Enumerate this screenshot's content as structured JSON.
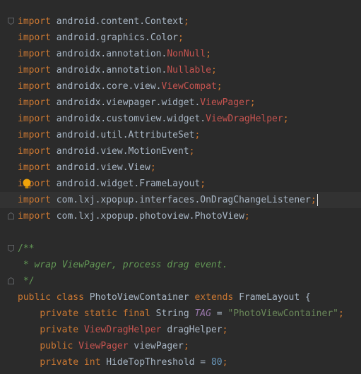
{
  "editor": {
    "lines": [
      {
        "tokens": [
          [
            "kw",
            "import"
          ],
          [
            "pkg",
            " android.content.Context"
          ],
          [
            "semi",
            ";"
          ]
        ]
      },
      {
        "tokens": [
          [
            "kw",
            "import"
          ],
          [
            "pkg",
            " android.graphics.Color"
          ],
          [
            "semi",
            ";"
          ]
        ]
      },
      {
        "tokens": [
          [
            "kw",
            "import"
          ],
          [
            "pkg",
            " androidx.annotation."
          ],
          [
            "cls-red",
            "NonNull"
          ],
          [
            "semi",
            ";"
          ]
        ]
      },
      {
        "tokens": [
          [
            "kw",
            "import"
          ],
          [
            "pkg",
            " androidx.annotation."
          ],
          [
            "cls-red",
            "Nullable"
          ],
          [
            "semi",
            ";"
          ]
        ]
      },
      {
        "tokens": [
          [
            "kw",
            "import"
          ],
          [
            "pkg",
            " androidx.core.view."
          ],
          [
            "cls-red",
            "ViewCompat"
          ],
          [
            "semi",
            ";"
          ]
        ]
      },
      {
        "tokens": [
          [
            "kw",
            "import"
          ],
          [
            "pkg",
            " androidx.viewpager.widget."
          ],
          [
            "cls-red",
            "ViewPager"
          ],
          [
            "semi",
            ";"
          ]
        ]
      },
      {
        "tokens": [
          [
            "kw",
            "import"
          ],
          [
            "pkg",
            " androidx.customview.widget."
          ],
          [
            "cls-red",
            "ViewDragHelper"
          ],
          [
            "semi",
            ";"
          ]
        ]
      },
      {
        "tokens": [
          [
            "kw",
            "import"
          ],
          [
            "pkg",
            " android.util.AttributeSet"
          ],
          [
            "semi",
            ";"
          ]
        ]
      },
      {
        "tokens": [
          [
            "kw",
            "import"
          ],
          [
            "pkg",
            " android.view.MotionEvent"
          ],
          [
            "semi",
            ";"
          ]
        ]
      },
      {
        "tokens": [
          [
            "kw",
            "import"
          ],
          [
            "pkg",
            " android.view.View"
          ],
          [
            "semi",
            ";"
          ]
        ]
      },
      {
        "tokens": [
          [
            "kw",
            "import"
          ],
          [
            "pkg",
            " android.widget.FrameLayout"
          ],
          [
            "semi",
            ";"
          ]
        ]
      },
      {
        "tokens": [
          [
            "kw",
            "import"
          ],
          [
            "pkg",
            " com.lxj.xpopup.interfaces.OnDragChangeListener"
          ],
          [
            "semi",
            ";"
          ]
        ]
      },
      {
        "tokens": [
          [
            "kw",
            "import"
          ],
          [
            "pkg",
            " com.lxj.xpopup.photoview.PhotoView"
          ],
          [
            "semi",
            ";"
          ]
        ]
      },
      {
        "tokens": []
      },
      {
        "tokens": [
          [
            "cdoc",
            "/**"
          ]
        ]
      },
      {
        "tokens": [
          [
            "comment",
            " * wrap ViewPager, process drag event."
          ]
        ]
      },
      {
        "tokens": [
          [
            "cdoc",
            " */"
          ]
        ]
      },
      {
        "tokens": [
          [
            "kw",
            "public class"
          ],
          [
            "pkg",
            " PhotoViewContainer "
          ],
          [
            "kw",
            "extends"
          ],
          [
            "pkg",
            " FrameLayout {"
          ]
        ]
      },
      {
        "tokens": [
          [
            "pkg",
            "    "
          ],
          [
            "kw",
            "private static final"
          ],
          [
            "pkg",
            " String "
          ],
          [
            "const",
            "TAG"
          ],
          [
            "pkg",
            " = "
          ],
          [
            "str",
            "\"PhotoViewContainer\""
          ],
          [
            "semi",
            ";"
          ]
        ]
      },
      {
        "tokens": [
          [
            "pkg",
            "    "
          ],
          [
            "kw",
            "private"
          ],
          [
            "pkg",
            " "
          ],
          [
            "cls-red",
            "ViewDragHelper"
          ],
          [
            "pkg",
            " dragHelper"
          ],
          [
            "semi",
            ";"
          ]
        ]
      },
      {
        "tokens": [
          [
            "pkg",
            "    "
          ],
          [
            "kw",
            "public"
          ],
          [
            "pkg",
            " "
          ],
          [
            "cls-red",
            "ViewPager"
          ],
          [
            "pkg",
            " viewPager"
          ],
          [
            "semi",
            ";"
          ]
        ]
      },
      {
        "tokens": [
          [
            "pkg",
            "    "
          ],
          [
            "kw",
            "private int"
          ],
          [
            "pkg",
            " HideTopThreshold = "
          ],
          [
            "num",
            "80"
          ],
          [
            "semi",
            ";"
          ]
        ]
      }
    ],
    "current_line": 11,
    "bulb_line": 10,
    "fold_lines": [
      0,
      12,
      14,
      16
    ],
    "colors": {
      "background": "#2b2b2b",
      "keyword": "#cc7832",
      "unresolved": "#c75450",
      "comment": "#629755",
      "string": "#6a8759",
      "number": "#6897bb",
      "constant": "#9876aa"
    },
    "icons": {
      "bulb": "lightbulb-icon",
      "fold": "fold-marker-icon"
    }
  }
}
